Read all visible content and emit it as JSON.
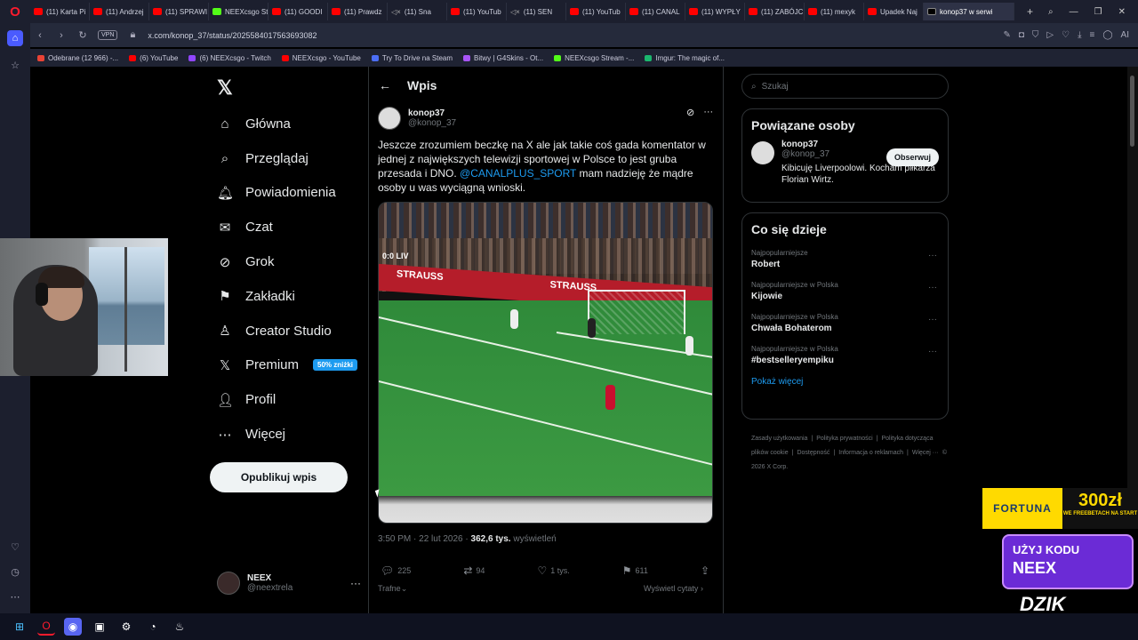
{
  "browser": {
    "tabs": [
      {
        "label": "(11) Karta Pi",
        "icon": "youtube-icon"
      },
      {
        "label": "(11) Andrzej",
        "icon": "youtube-icon"
      },
      {
        "label": "(11) SPRAWI",
        "icon": "youtube-icon"
      },
      {
        "label": "NEEXcsgo St",
        "icon": "kick-icon"
      },
      {
        "label": "(11) GOODI",
        "icon": "youtube-icon"
      },
      {
        "label": "(11) Prawdz",
        "icon": "youtube-icon"
      },
      {
        "label": "(11) Sna",
        "icon": "sound-icon"
      },
      {
        "label": "(11) YouTub",
        "icon": "youtube-icon"
      },
      {
        "label": "(11) SEN",
        "icon": "sound-icon"
      },
      {
        "label": "(11) YouTub",
        "icon": "youtube-icon"
      },
      {
        "label": "(11) CANAL",
        "icon": "youtube-icon"
      },
      {
        "label": "(11) WYPŁY",
        "icon": "youtube-icon"
      },
      {
        "label": "(11) ZABÓJC",
        "icon": "youtube-icon"
      },
      {
        "label": "(11) mexyk",
        "icon": "youtube-icon"
      },
      {
        "label": "Upadek Naj",
        "icon": "youtube-icon"
      },
      {
        "label": "konop37 w serwi",
        "icon": "x-icon",
        "active": true
      }
    ],
    "url": "x.com/konop_37/status/2025584017563693082",
    "vpn_label": "VPN",
    "ai_label": "AI",
    "bookmarks": [
      {
        "label": "Odebrane (12 966) -..."
      },
      {
        "label": "(6) YouTube"
      },
      {
        "label": "(6) NEEXcsgo - Twitch"
      },
      {
        "label": "NEEXcsgo - YouTube"
      },
      {
        "label": "Try To Drive na Steam"
      },
      {
        "label": "Bitwy | G4Skins - Ot..."
      },
      {
        "label": "NEEXcsgo Stream -..."
      },
      {
        "label": "Imgur: The magic of..."
      }
    ]
  },
  "nav": {
    "items": [
      {
        "label": "Główna",
        "icon": "home-icon"
      },
      {
        "label": "Przeglądaj",
        "icon": "search-icon"
      },
      {
        "label": "Powiadomienia",
        "icon": "bell-icon"
      },
      {
        "label": "Czat",
        "icon": "mail-icon"
      },
      {
        "label": "Grok",
        "icon": "grok-icon"
      },
      {
        "label": "Zakładki",
        "icon": "bookmark-icon"
      },
      {
        "label": "Creator Studio",
        "icon": "creator-icon"
      },
      {
        "label": "Premium",
        "icon": "x-icon",
        "badge": "50% zniżki"
      },
      {
        "label": "Profil",
        "icon": "person-icon"
      },
      {
        "label": "Więcej",
        "icon": "more-icon"
      }
    ],
    "post_button": "Opublikuj wpis",
    "account": {
      "name": "NEEX",
      "handle": "@neextrela",
      "more": "···"
    }
  },
  "post": {
    "header_title": "Wpis",
    "author_name": "konop37",
    "author_handle": "@konop_37",
    "text_before": "Jeszcze zrozumiem beczkę na X ale jak takie coś gada komentator w jednej z największych telewizji sportowej w Polsce to jest gruba przesada i DNO. ",
    "mention": "@CANALPLUS_SPORT",
    "text_after": " mam nadzieję że mądre osoby u was wyciągną wnioski.",
    "timestamp": "3:50 PM · 22 lut 2026 · ",
    "views_count": "362,6 tys.",
    "views_label": " wyświetleń",
    "replies": "225",
    "reposts": "94",
    "likes": "1 tys.",
    "bookmarks": "611",
    "reply_sort": "Trafne",
    "quotes_link": "Wyświetl cytaty",
    "video": {
      "board_text": "STRAUSS",
      "score_text": "0:0 LIV"
    }
  },
  "right": {
    "search_placeholder": "Szukaj",
    "related_title": "Powiązane osoby",
    "related_person": {
      "name": "konop37",
      "handle": "@konop_37",
      "bio": "Kibicuję Liverpoolowi. Kocham piłkarza Florian Wirtz.",
      "follow_label": "Obserwuj"
    },
    "trends_title": "Co się dzieje",
    "trends": [
      {
        "sub": "Najpopularniejsze",
        "title": "Robert"
      },
      {
        "sub": "Najpopularniejsze w Polska",
        "title": "Kijowie"
      },
      {
        "sub": "Najpopularniejsze w Polska",
        "title": "Chwała Bohaterom"
      },
      {
        "sub": "Najpopularniejsze w Polska",
        "title": "#bestselleryempiku"
      }
    ],
    "show_more": "Pokaż więcej",
    "footer": [
      "Zasady użytkowania",
      "|",
      "Polityka prywatności",
      "|",
      "Polityka dotycząca plików cookie",
      "|",
      "Dostępność",
      "|",
      "Informacja o reklamach",
      "|",
      "Więcej ···",
      "© 2026 X Corp."
    ]
  },
  "ads": {
    "fortuna": "FORTUNA",
    "amount": "300zł",
    "amount_sub": "WE FREEBETACH NA START",
    "code_label": "UŻYJ KODU",
    "code": "NEEX",
    "dzik": "DZIK"
  },
  "colors": {
    "accent": "#1d9bf0",
    "background": "#000000",
    "opera_red": "#ff1b2d"
  }
}
